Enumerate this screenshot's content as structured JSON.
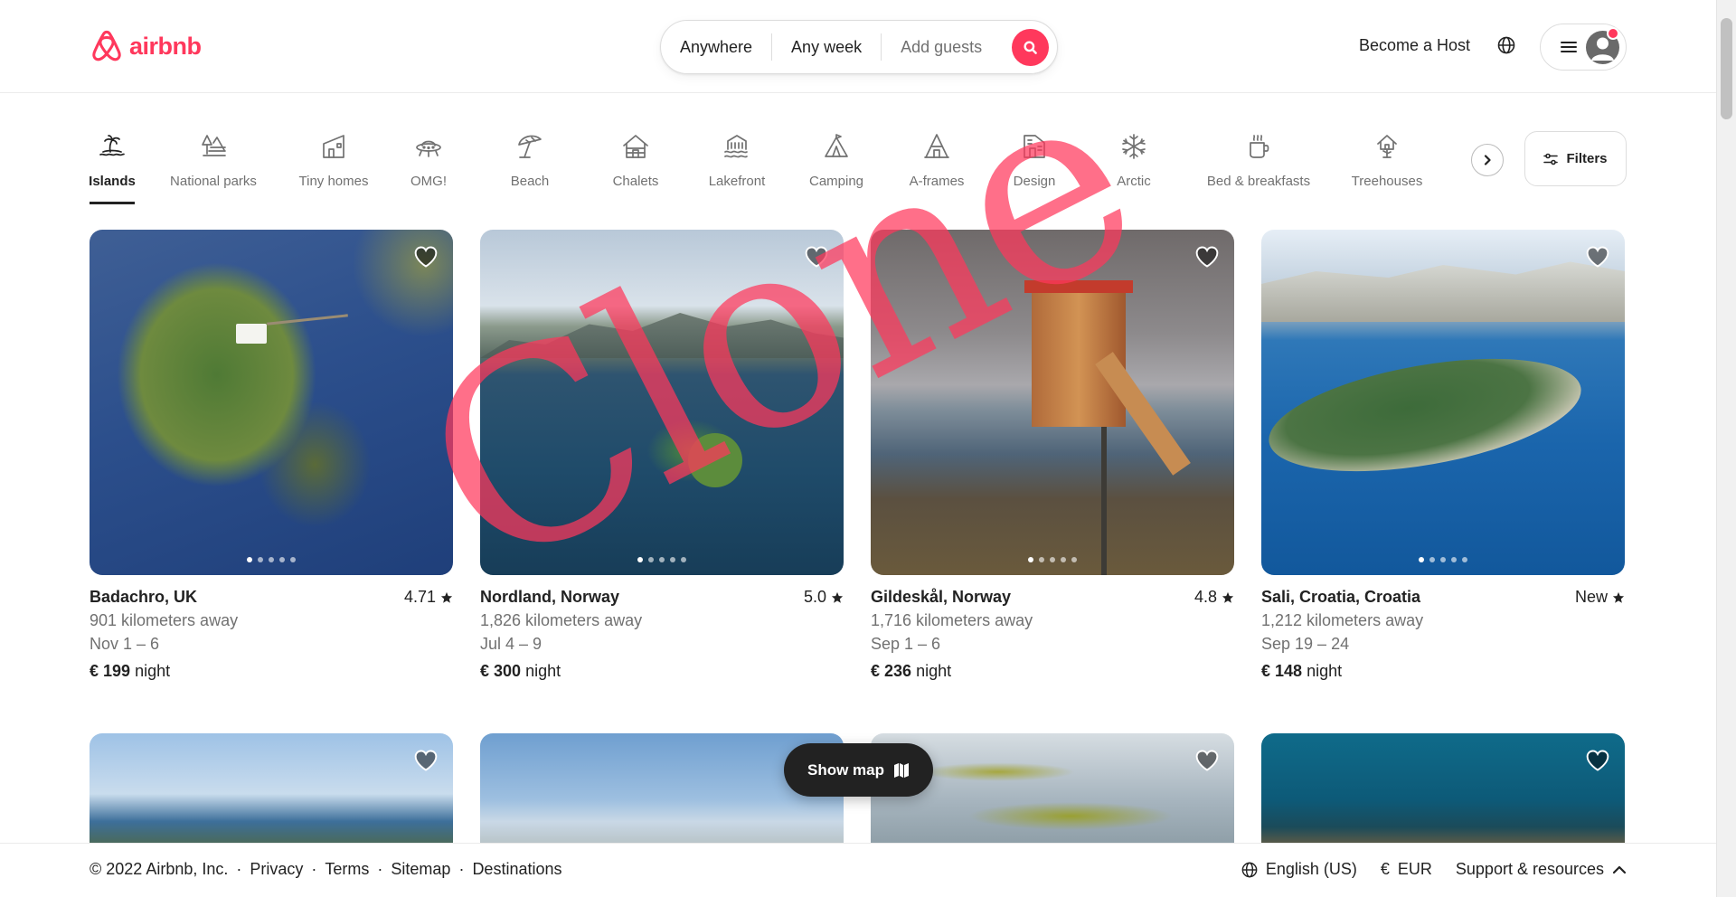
{
  "header": {
    "brand": "airbnb",
    "search": {
      "location": "Anywhere",
      "dates": "Any week",
      "guests": "Add guests"
    },
    "host_link": "Become a Host"
  },
  "categories": [
    {
      "label": "Islands",
      "icon": "island-icon",
      "active": true
    },
    {
      "label": "National parks",
      "icon": "national-park-icon"
    },
    {
      "label": "Tiny homes",
      "icon": "tiny-home-icon"
    },
    {
      "label": "OMG!",
      "icon": "ufo-icon"
    },
    {
      "label": "Beach",
      "icon": "beach-umbrella-icon"
    },
    {
      "label": "Chalets",
      "icon": "chalet-icon"
    },
    {
      "label": "Lakefront",
      "icon": "lakefront-icon"
    },
    {
      "label": "Camping",
      "icon": "tent-icon"
    },
    {
      "label": "A-frames",
      "icon": "a-frame-icon"
    },
    {
      "label": "Design",
      "icon": "design-icon"
    },
    {
      "label": "Arctic",
      "icon": "snowflake-icon"
    },
    {
      "label": "Bed & breakfasts",
      "icon": "coffee-mug-icon"
    },
    {
      "label": "Treehouses",
      "icon": "treehouse-icon"
    }
  ],
  "filters_label": "Filters",
  "listings": [
    {
      "location": "Badachro, UK",
      "rating": "4.71",
      "distance": "901 kilometers away",
      "dates": "Nov 1 – 6",
      "price": "€ 199",
      "unit": "night"
    },
    {
      "location": "Nordland, Norway",
      "rating": "5.0",
      "distance": "1,826 kilometers away",
      "dates": "Jul 4 – 9",
      "price": "€ 300",
      "unit": "night"
    },
    {
      "location": "Gildeskål, Norway",
      "rating": "4.8",
      "distance": "1,716 kilometers away",
      "dates": "Sep 1 – 6",
      "price": "€ 236",
      "unit": "night"
    },
    {
      "location": "Sali, Croatia, Croatia",
      "rating": "New",
      "distance": "1,212 kilometers away",
      "dates": "Sep 19 – 24",
      "price": "€ 148",
      "unit": "night"
    }
  ],
  "show_map_label": "Show map",
  "footer": {
    "copyright": "© 2022 Airbnb, Inc.",
    "sep": "·",
    "links": [
      "Privacy",
      "Terms",
      "Sitemap",
      "Destinations"
    ],
    "language": "English (US)",
    "currency_symbol": "€",
    "currency": "EUR",
    "support": "Support & resources"
  },
  "watermark": "Clone",
  "colors": {
    "brand": "#ff385c",
    "text": "#222222",
    "muted": "#717171"
  }
}
